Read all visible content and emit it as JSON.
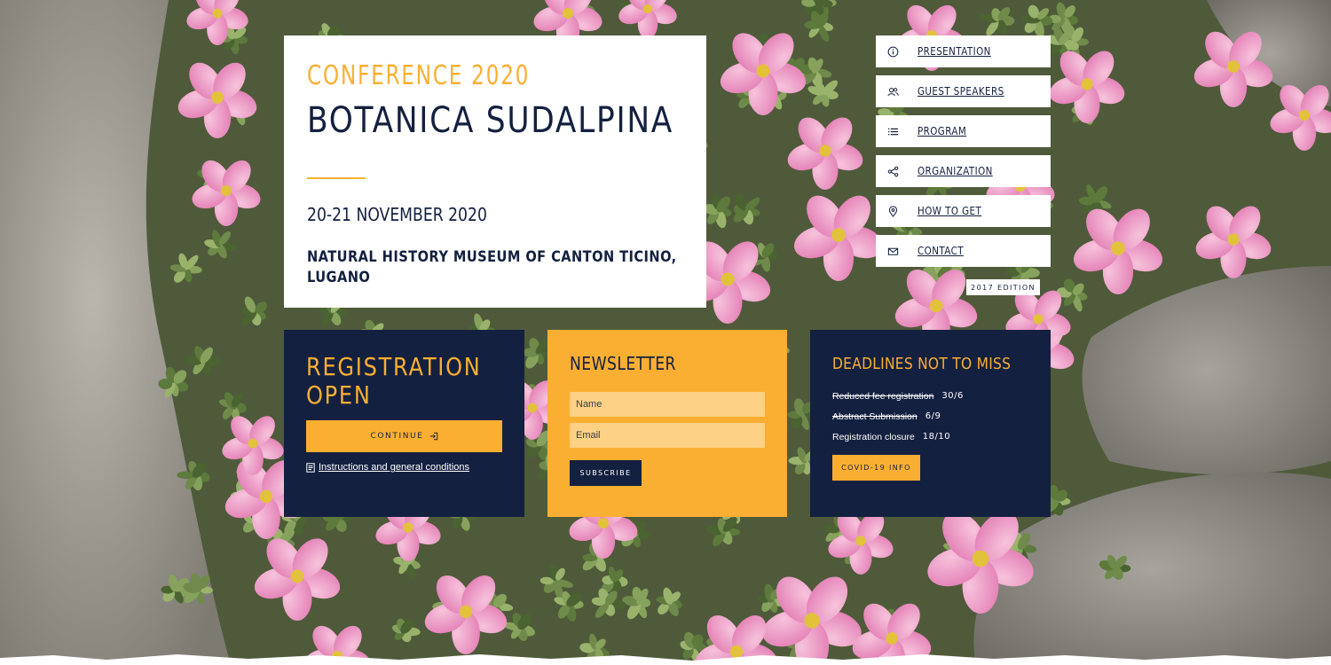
{
  "hero": {
    "kicker": "CONFERENCE 2020",
    "title": "BOTANICA SUDALPINA",
    "date": "20-21 NOVEMBER 2020",
    "venue": "NATURAL HISTORY MUSEUM OF CANTON TICINO, LUGANO"
  },
  "nav": {
    "items": [
      {
        "label": "PRESENTATION",
        "icon": "info-icon"
      },
      {
        "label": "GUEST SPEAKERS",
        "icon": "speakers-icon"
      },
      {
        "label": "PROGRAM",
        "icon": "list-icon"
      },
      {
        "label": "ORGANIZATION",
        "icon": "share-icon"
      },
      {
        "label": "HOW TO GET",
        "icon": "location-pin-icon"
      },
      {
        "label": "CONTACT",
        "icon": "envelope-icon"
      }
    ],
    "edition": "2017 EDITION"
  },
  "registration": {
    "title_line1": "REGISTRATION",
    "title_line2": "OPEN",
    "button": "CONTINUE",
    "link": "Instructions and general conditions"
  },
  "newsletter": {
    "title": "NEWSLETTER",
    "name_placeholder": "Name",
    "email_placeholder": "Email",
    "button": "SUBSCRIBE"
  },
  "deadlines": {
    "title": "DEADLINES NOT TO MISS",
    "items": [
      {
        "label": "Reduced fee registration",
        "date": "30/6",
        "passed": true
      },
      {
        "label": "Abstract Submission",
        "date": "6/9",
        "passed": true
      },
      {
        "label": "Registration closure",
        "date": "18/10",
        "passed": false
      }
    ],
    "button": "COVID-19 INFO"
  },
  "colors": {
    "navy": "#142040",
    "accent": "#fbaf32",
    "white": "#ffffff"
  }
}
